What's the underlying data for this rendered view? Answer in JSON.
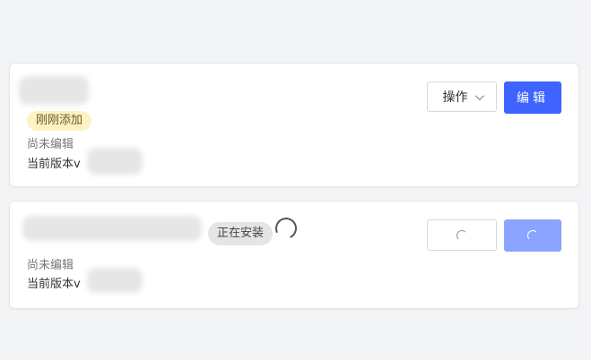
{
  "cards": [
    {
      "tag": "刚刚添加",
      "status": "尚未编辑",
      "version_prefix": "当前版本v",
      "actions_label": "操作",
      "edit_label": "编辑"
    },
    {
      "tag": "正在安装",
      "status": "尚未编辑",
      "version_prefix": "当前版本v"
    }
  ],
  "colors": {
    "primary": "#3e63ff",
    "primary_loading": "#8ba4ff",
    "added_tag_bg": "#fdf1c6",
    "installing_tag_bg": "#e5e5e5",
    "page_bg": "#f3f4f6"
  },
  "icons": [
    "chevron-down-icon",
    "loading-spinner-icon"
  ]
}
